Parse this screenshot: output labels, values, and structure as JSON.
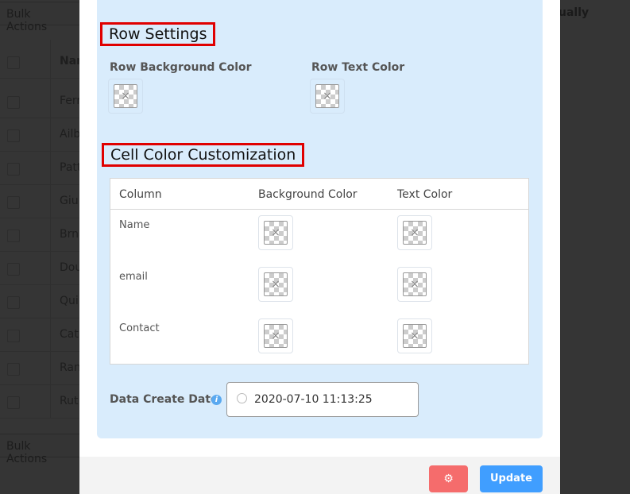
{
  "background": {
    "bulk_actions_label": "Bulk Actions",
    "column_header_partial": "Nar",
    "header_right_partial": "ually",
    "rows": [
      "Ferr",
      "Ailb",
      "Patt",
      "Giul",
      "Brna",
      "Dou",
      "Qui",
      "Cati",
      "Ran",
      "Rut"
    ]
  },
  "modal": {
    "row_settings": {
      "title": "Row Settings",
      "bg_label": "Row Background Color",
      "text_label": "Row Text Color"
    },
    "cell_colors": {
      "title": "Cell Color Customization",
      "headers": [
        "Column",
        "Background Color",
        "Text Color"
      ],
      "rows": [
        "Name",
        "email",
        "Contact"
      ]
    },
    "date": {
      "label": "Data Create Date",
      "value": "2020-07-10 11:13:25",
      "info_icon": "i"
    },
    "footer": {
      "delete_icon": "gear-icon",
      "update_label": "Update"
    },
    "colors": {
      "panel": "#d9ecfc",
      "update": "#409eff",
      "danger": "#f56c6c",
      "highlight": "#e00000"
    }
  }
}
